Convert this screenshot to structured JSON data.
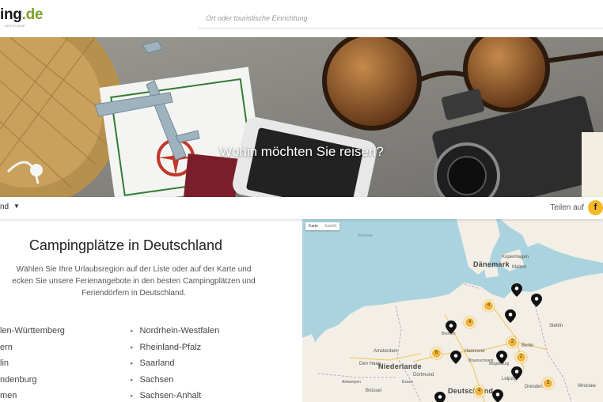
{
  "header": {
    "logo_main": "ing",
    "logo_tld": ".de",
    "logo_sub": "KESSCAMP",
    "search_placeholder": "Ort oder touristische Einrichtung"
  },
  "hero": {
    "title": "Wohin möchten Sie reisen?"
  },
  "subbar": {
    "country": "nd",
    "share_label": "Teilen auf",
    "facebook_glyph": "f"
  },
  "main": {
    "title": "Campingplätze in Deutschland",
    "intro": "Wählen Sie Ihre Urlaubsregion auf der Liste oder auf der Karte und\necken Sie unsere Ferienangebote in den besten Campingplätzen und\nFeriendörfern in Deutschland.",
    "regions_left": [
      "len-Württemberg",
      "ern",
      "lin",
      "ndenburg",
      "men"
    ],
    "regions_right": [
      "Nordrhein-Westfalen",
      "Rheinland-Pfalz",
      "Saarland",
      "Sachsen",
      "Sachsen-Anhalt"
    ]
  },
  "map": {
    "tabs": [
      "Karte",
      "Satellit"
    ],
    "labels": {
      "nordsee": "Nordsee",
      "daenemark": "Dänemark",
      "kopenhagen": "Kopenhagen",
      "malmo": "Malmö",
      "stettin": "Stettin",
      "berlin": "Berlin",
      "amsterdam": "Amsterdam",
      "den_haag": "Den Haag",
      "niederlande": "Niederlande",
      "hannover": "Hannover",
      "braunschweig": "Braunschweig",
      "dortmund": "Dortmund",
      "leipzig": "Leipzig",
      "dresden": "Dresden",
      "deutschland": "Deutschland",
      "bruessel": "Brüssel",
      "wroclaw": "Wroclaw",
      "magdeburg": "Magdeburg",
      "bremen": "Bremen",
      "essen": "Essen",
      "antwerpen": "Antwerpen"
    },
    "clusters": [
      "4",
      "4",
      "2",
      "2",
      "6",
      "4",
      "3"
    ]
  },
  "colors": {
    "accent": "#7aa12a",
    "cluster": "#f0b53a",
    "facebook_badge": "#f5b928",
    "sea": "#aad3df",
    "land": "#f3efe6"
  }
}
